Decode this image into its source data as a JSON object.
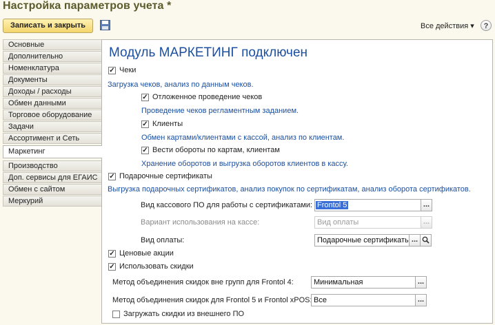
{
  "window": {
    "title": "Настройка параметров учета *"
  },
  "toolbar": {
    "save_close_label": "Записать и закрыть",
    "all_actions_label": "Все действия ▾",
    "help_label": "?"
  },
  "tabs": [
    {
      "label": "Основные"
    },
    {
      "label": "Дополнительно"
    },
    {
      "label": "Номенклатура"
    },
    {
      "label": "Документы"
    },
    {
      "label": "Доходы / расходы"
    },
    {
      "label": "Обмен данными"
    },
    {
      "label": "Торговое оборудование"
    },
    {
      "label": "Задачи"
    },
    {
      "label": "Ассортимент и Сеть"
    },
    {
      "label": "Маркетинг"
    },
    {
      "label": "Производство"
    },
    {
      "label": "Доп. сервисы для ЕГАИС"
    },
    {
      "label": "Обмен с сайтом"
    },
    {
      "label": "Меркурий"
    }
  ],
  "active_tab": "Маркетинг",
  "panel": {
    "title": "Модуль МАРКЕТИНГ подключен",
    "checks_label": "Чеки",
    "checks_hint": "Загрузка чеков, анализ по данным чеков.",
    "deferred_label": "Отложенное проведение чеков",
    "deferred_hint": "Проведение чеков регламентным заданием.",
    "clients_label": "Клиенты",
    "clients_hint": "Обмен картами/клиентами с кассой, анализ по клиентам.",
    "turnover_label": "Вести обороты по картам, клиентам",
    "turnover_hint": "Хранение оборотов и выгрузка оборотов клиентов в кассу.",
    "gift_label": "Подарочные сертификаты",
    "gift_hint": "Выгрузка подарочных сертификатов, анализ покупок по сертификатам, анализ оборота сертификатов.",
    "pos_software_label": "Вид кассового ПО для работы с сертификатами:",
    "pos_software_value": "Frontol 5",
    "usage_variant_label": "Вариант использования на кассе:",
    "usage_variant_value": "Вид оплаты",
    "payment_type_label": "Вид оплаты:",
    "payment_type_value": "Подарочные сертификаты",
    "promo_label": "Ценовые акции",
    "discounts_label": "Использовать скидки",
    "method4_label": "Метод объединения скидок вне групп для Frontol 4:",
    "method4_value": "Минимальная",
    "method5_label": "Метод объединения скидок для Frontol 5 и Frontol xPOS:",
    "method5_value": "Все",
    "external_label": "Загружать скидки из внешнего ПО",
    "button_dots": "...",
    "check_mark": "✓"
  }
}
